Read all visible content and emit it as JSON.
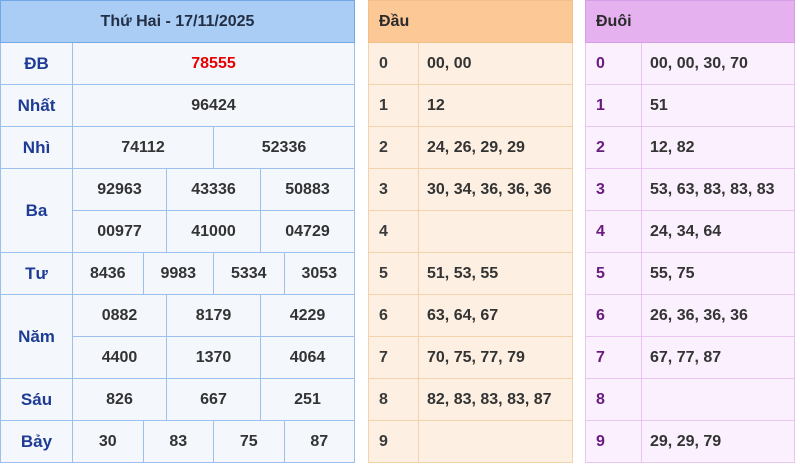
{
  "results": {
    "title": "Thứ Hai - 17/11/2025",
    "rows": {
      "db": {
        "label": "ĐB",
        "values": [
          "78555"
        ]
      },
      "nhat": {
        "label": "Nhất",
        "values": [
          "96424"
        ]
      },
      "nhi": {
        "label": "Nhì",
        "values": [
          "74112",
          "52336"
        ]
      },
      "ba": {
        "label": "Ba",
        "values": [
          "92963",
          "43336",
          "50883",
          "00977",
          "41000",
          "04729"
        ]
      },
      "tu": {
        "label": "Tư",
        "values": [
          "8436",
          "9983",
          "5334",
          "3053"
        ]
      },
      "nam": {
        "label": "Năm",
        "values": [
          "0882",
          "8179",
          "4229",
          "4400",
          "1370",
          "4064"
        ]
      },
      "sau": {
        "label": "Sáu",
        "values": [
          "826",
          "667",
          "251"
        ]
      },
      "bay": {
        "label": "Bảy",
        "values": [
          "30",
          "83",
          "75",
          "87"
        ]
      }
    },
    "colors": {
      "special_prize": "#e60000",
      "header": "#aacdf5"
    }
  },
  "dau": {
    "header": "Đầu",
    "rows": [
      {
        "key": "0",
        "val": "00, 00"
      },
      {
        "key": "1",
        "val": "12"
      },
      {
        "key": "2",
        "val": "24, 26, 29, 29"
      },
      {
        "key": "3",
        "val": "30, 34, 36, 36, 36"
      },
      {
        "key": "4",
        "val": ""
      },
      {
        "key": "5",
        "val": "51, 53, 55"
      },
      {
        "key": "6",
        "val": "63, 64, 67"
      },
      {
        "key": "7",
        "val": "70, 75, 77, 79"
      },
      {
        "key": "8",
        "val": "82, 83, 83, 83, 87"
      },
      {
        "key": "9",
        "val": ""
      }
    ]
  },
  "duoi": {
    "header": "Đuôi",
    "rows": [
      {
        "key": "0",
        "val": "00, 00, 30, 70"
      },
      {
        "key": "1",
        "val": "51"
      },
      {
        "key": "2",
        "val": "12, 82"
      },
      {
        "key": "3",
        "val": "53, 63, 83, 83, 83"
      },
      {
        "key": "4",
        "val": "24, 34, 64"
      },
      {
        "key": "5",
        "val": "55, 75"
      },
      {
        "key": "6",
        "val": "26, 36, 36, 36"
      },
      {
        "key": "7",
        "val": "67, 77, 87"
      },
      {
        "key": "8",
        "val": ""
      },
      {
        "key": "9",
        "val": "29, 29, 79"
      }
    ]
  }
}
